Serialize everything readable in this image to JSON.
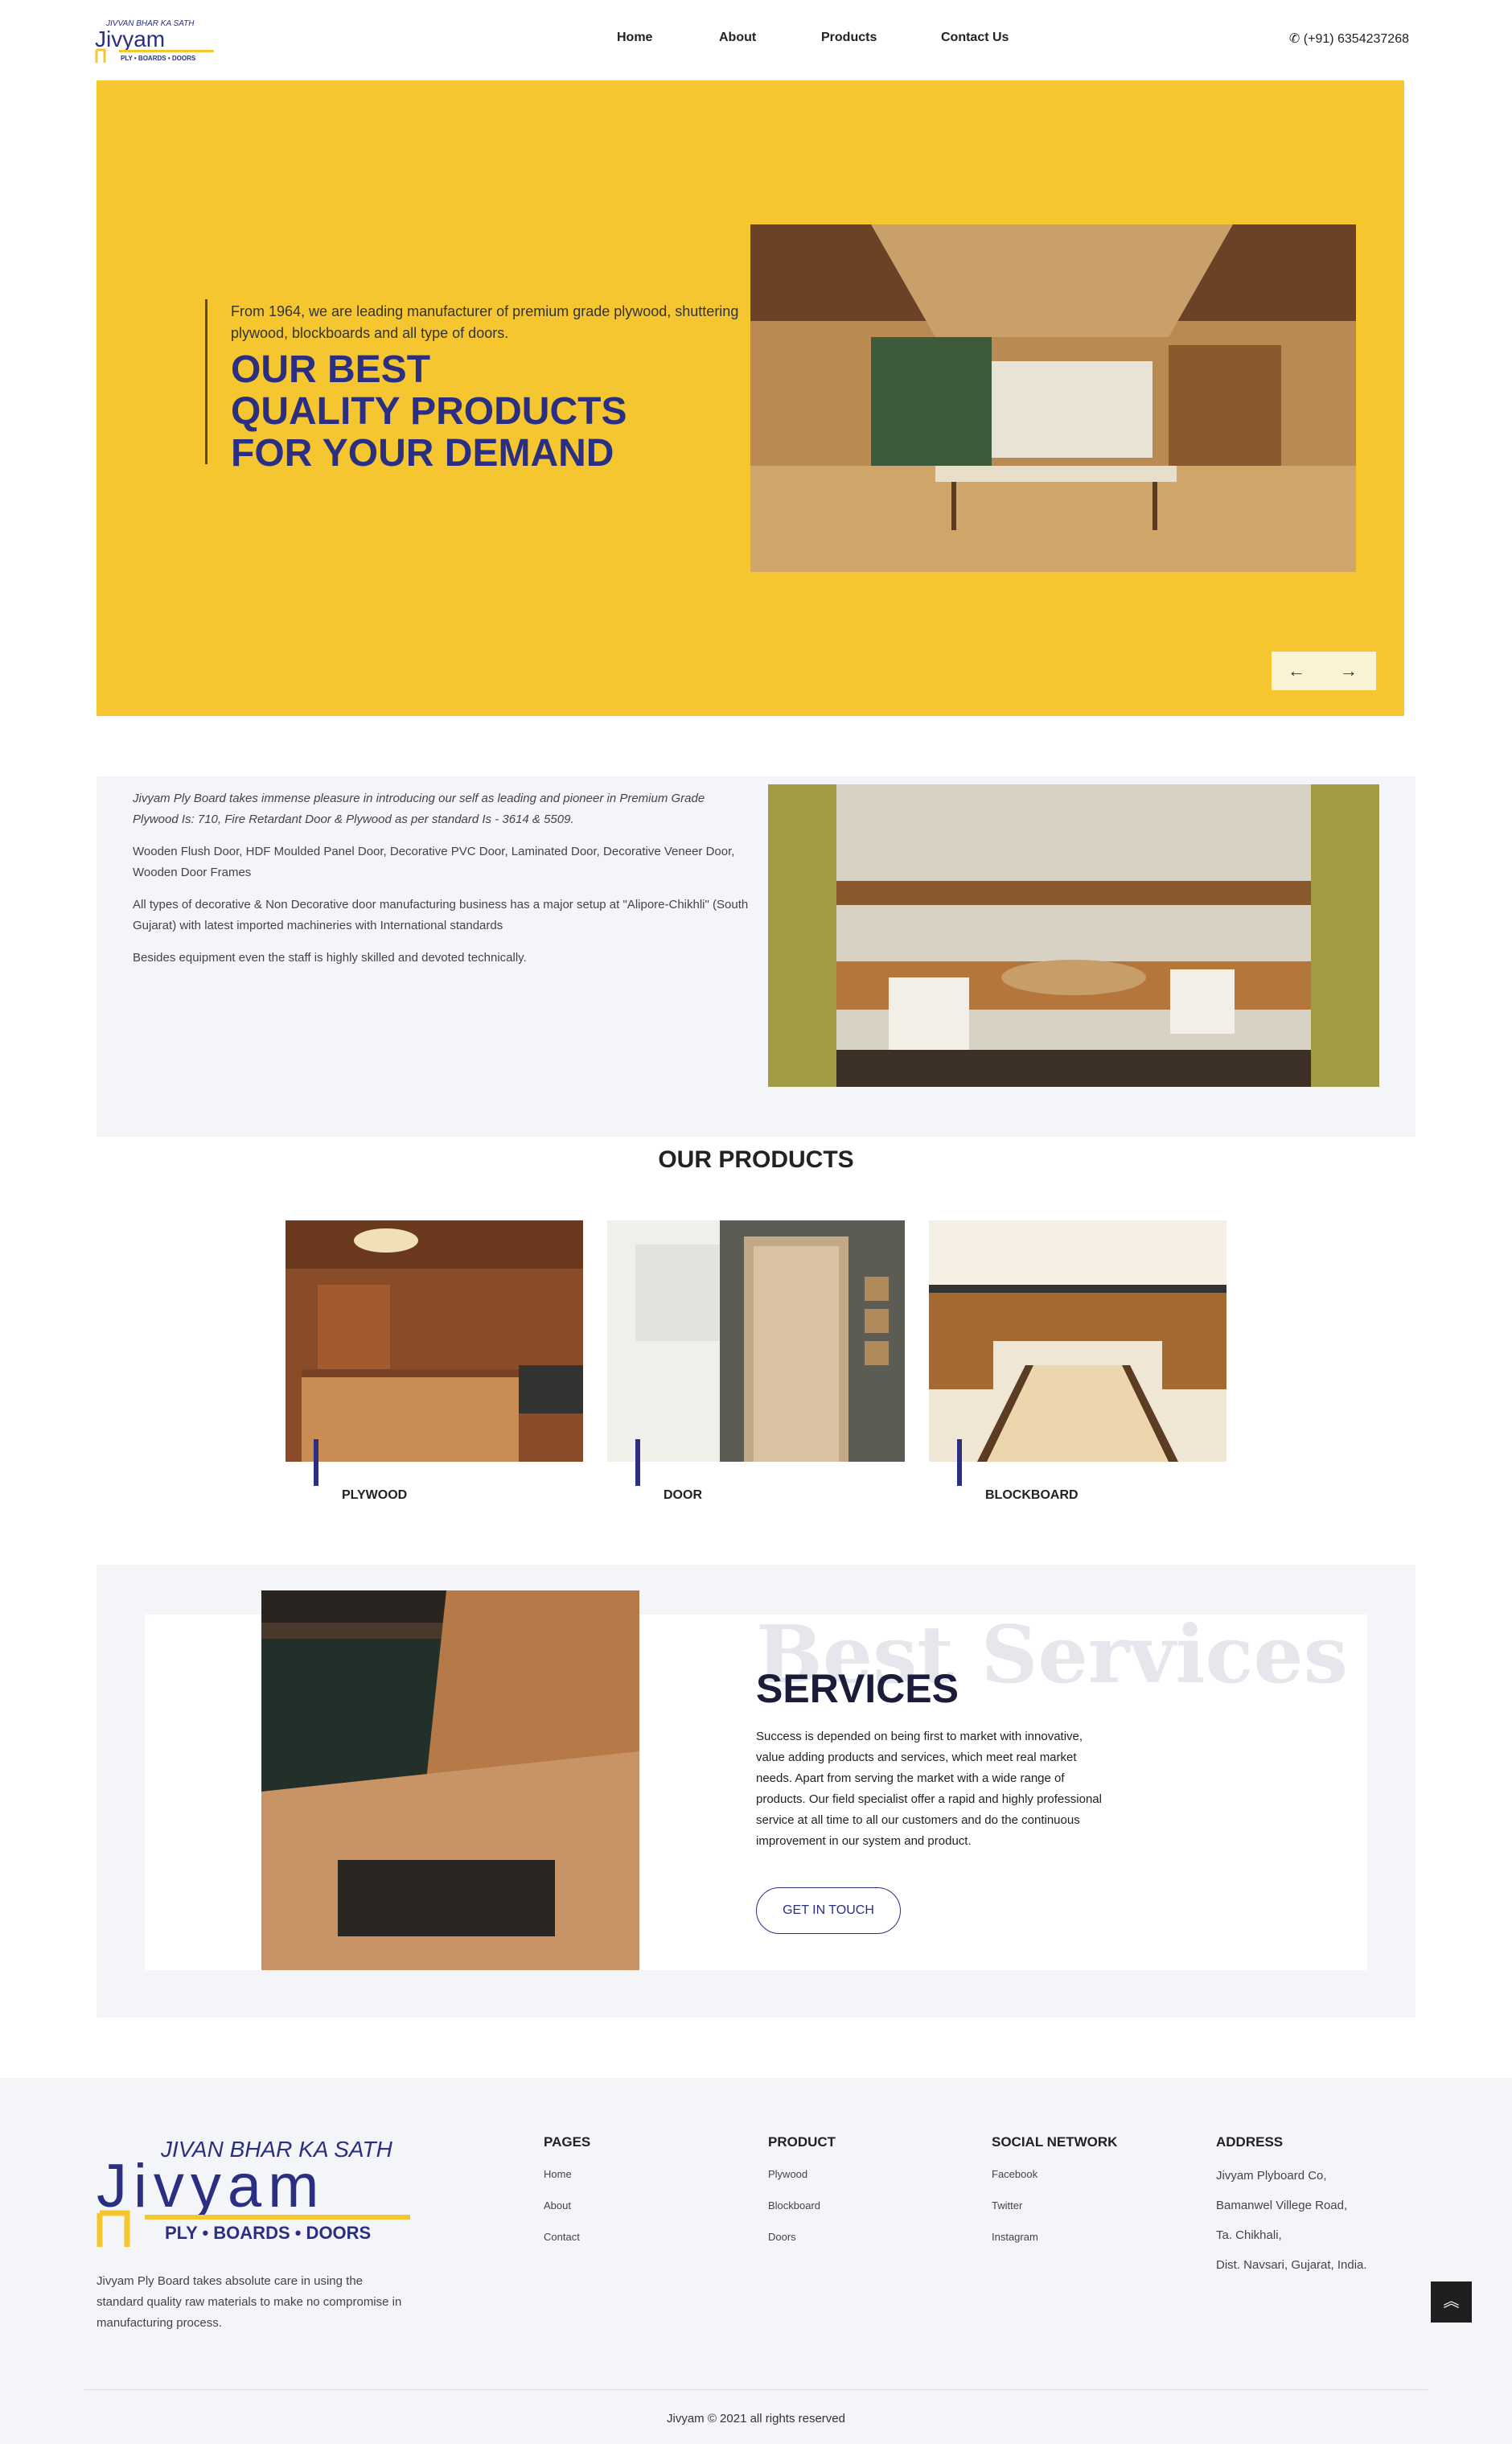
{
  "brand": {
    "tagline": "JIVVAN BHAR KA SATH",
    "name": "Jivyam",
    "sub": "PLY • BOARDS • DOORS",
    "footer_tagline": "JIVAN BHAR KA SATH"
  },
  "nav": {
    "items": [
      "Home",
      "About",
      "Products",
      "Contact Us"
    ],
    "phone": "(+91) 6354237268"
  },
  "hero": {
    "subtitle": "From 1964, we are leading manufacturer of premium grade plywood, shuttering plywood, blockboards and all type of doors.",
    "title_lines": [
      "OUR BEST",
      "QUALITY PRODUCTS",
      "FOR YOUR DEMAND"
    ],
    "prev": "←",
    "next": "→"
  },
  "about": {
    "paragraphs": [
      "Jivyam Ply Board takes immense pleasure in introducing our self as leading and pioneer in Premium Grade Plywood Is: 710, Fire Retardant Door & Plywood as per standard Is - 3614 & 5509.",
      "Wooden Flush Door, HDF Moulded Panel Door, Decorative PVC Door, Laminated Door, Decorative Veneer Door, Wooden Door Frames",
      "All types of decorative & Non Decorative door manufacturing business has a major setup at \"Alipore-Chikhli\" (South Gujarat) with latest imported machineries with International standards",
      "Besides equipment even the staff is highly skilled and devoted technically."
    ]
  },
  "products": {
    "title": "OUR PRODUCTS",
    "items": [
      {
        "label": "PLYWOOD"
      },
      {
        "label": "DOOR"
      },
      {
        "label": "BLOCKBOARD"
      }
    ]
  },
  "services": {
    "bg_text": "Best Services",
    "title": "SERVICES",
    "text": "Success is depended on being first to market with innovative, value adding products and services, which meet real market needs. Apart from serving the market with a wide range of products. Our field specialist offer a rapid and highly professional service at all time to all our customers and do the continuous improvement in our system and product.",
    "button": "GET IN TOUCH"
  },
  "footer": {
    "description": "Jivyam Ply Board takes absolute care in using the standard quality raw materials to make no compromise in manufacturing process.",
    "pages": {
      "heading": "PAGES",
      "links": [
        "Home",
        "About",
        "Contact"
      ]
    },
    "product": {
      "heading": "PRODUCT",
      "links": [
        "Plywood",
        "Blockboard",
        "Doors"
      ]
    },
    "social": {
      "heading": "SOCIAL NETWORK",
      "links": [
        "Facebook",
        "Twitter",
        "Instagram"
      ]
    },
    "address": {
      "heading": "ADDRESS",
      "lines": [
        "Jivyam Plyboard Co,",
        "Bamanwel Villege Road,",
        "Ta. Chikhali,",
        "Dist. Navsari, Gujarat, India."
      ]
    },
    "copyright": "Jivyam © 2021 all rights reserved"
  },
  "colors": {
    "accent": "#f5c62f",
    "brand_blue": "#2b2f82",
    "light_bg": "#f4f5f8"
  }
}
